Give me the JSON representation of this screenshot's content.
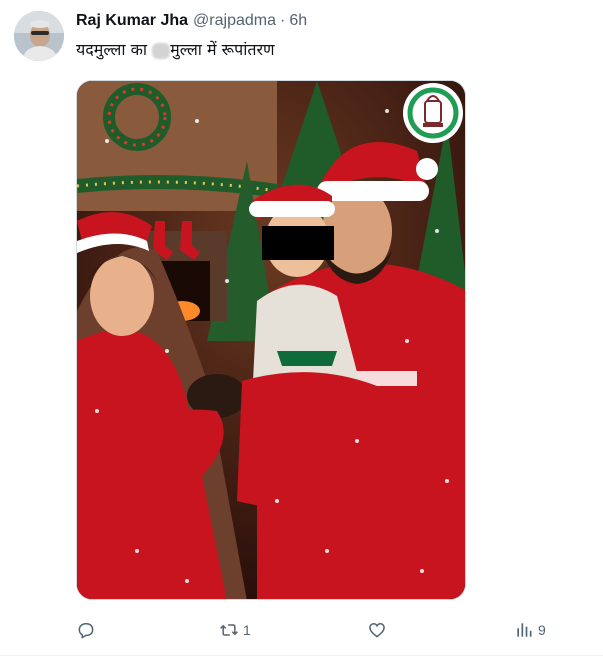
{
  "author": {
    "name": "Raj Kumar Jha",
    "handle": "@rajpadma",
    "separator": "·",
    "time": "6h"
  },
  "tweet": {
    "text_before": "यदमुल्ला का ",
    "text_after": "मुल्ला में रूपांतरण"
  },
  "media": {
    "description_icon": "lantern-logo-icon",
    "colors": {
      "red": "#c8141e",
      "green": "#0f6b3a",
      "logo_ring": "#1f9d55"
    }
  },
  "actions": {
    "reply": {
      "icon": "reply-icon",
      "count": ""
    },
    "retweet": {
      "icon": "retweet-icon",
      "count": "1"
    },
    "like": {
      "icon": "heart-icon",
      "count": ""
    },
    "views": {
      "icon": "views-icon",
      "count": "9"
    }
  }
}
